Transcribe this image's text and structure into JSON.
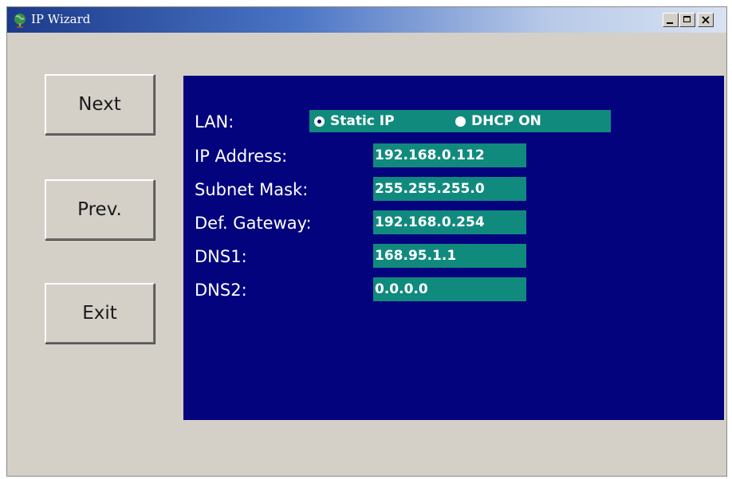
{
  "window": {
    "title": "IP Wizard",
    "icon": "network-globe-icon"
  },
  "title_buttons": {
    "minimize": "minimize-icon",
    "maximize": "maximize-icon",
    "close": "close-icon"
  },
  "nav": {
    "next_label": "Next",
    "prev_label": "Prev.",
    "exit_label": "Exit"
  },
  "settings": {
    "lan": {
      "label": "LAN:",
      "options": [
        "Static IP",
        "DHCP ON"
      ],
      "selected": "Static IP"
    },
    "fields": [
      {
        "label": "IP Address:",
        "value": "192.168.0.112"
      },
      {
        "label": "Subnet Mask:",
        "value": "255.255.255.0"
      },
      {
        "label": "Def. Gateway:",
        "value": "192.168.0.254"
      },
      {
        "label": "DNS1:",
        "value": "168.95.1.1"
      },
      {
        "label": "DNS2:",
        "value": "0.0.0.0"
      }
    ]
  },
  "colors": {
    "panel": "#03037d",
    "field_bg": "#118a7e",
    "window_bg": "#d4d0c8"
  }
}
